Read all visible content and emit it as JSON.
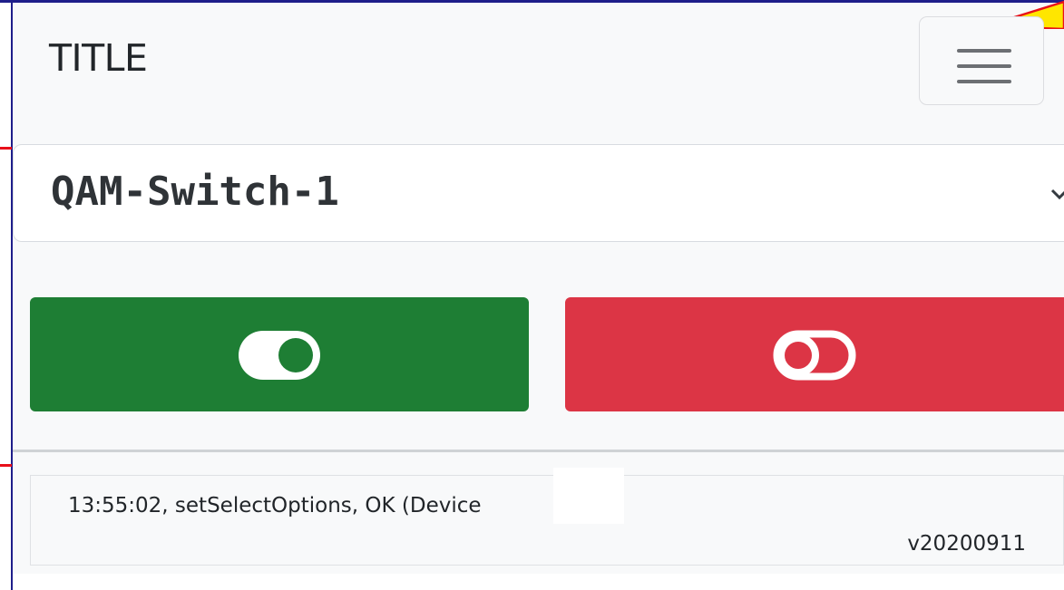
{
  "header": {
    "title": "TITLE",
    "menu_icon": "hamburger-menu-icon"
  },
  "device_select": {
    "selected": "QAM-Switch-1",
    "icon": "chevron-down-icon"
  },
  "actions": {
    "on_button_icon": "toggle-on-icon",
    "off_button_icon": "toggle-off-icon",
    "on_color": "#1e7e34",
    "off_color": "#dc3545"
  },
  "log": {
    "message": "13:55:02, setSelectOptions, OK (Device",
    "version": "v20200911"
  }
}
